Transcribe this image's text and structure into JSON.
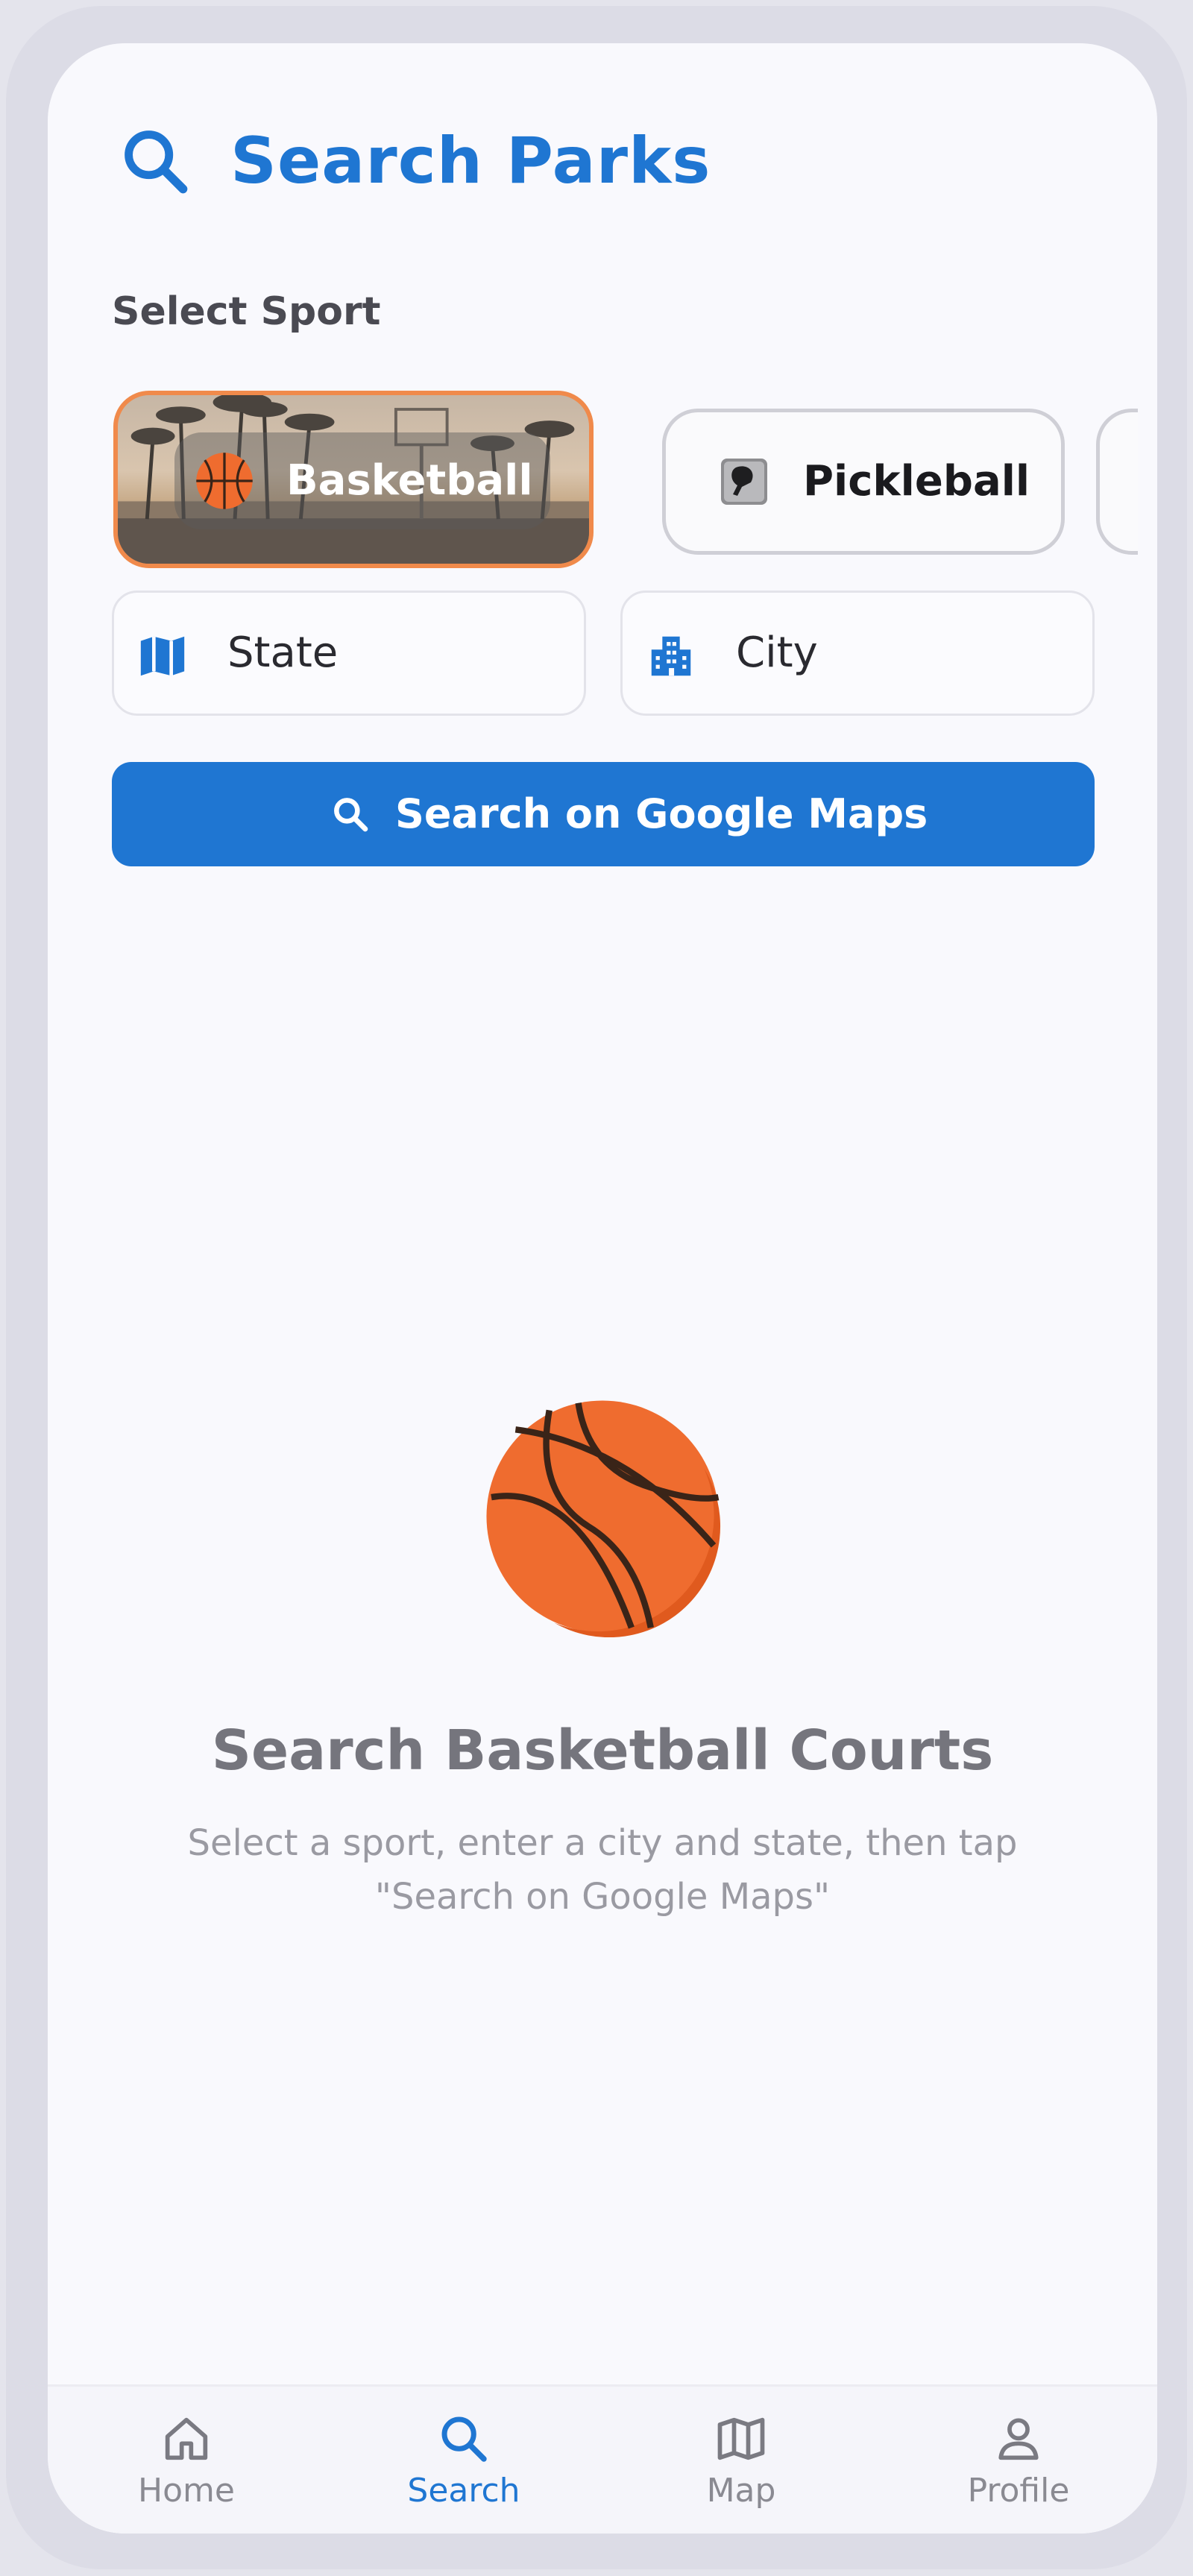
{
  "header": {
    "title": "Search Parks",
    "icon": "search-icon"
  },
  "sport_section": {
    "label": "Select Sport",
    "selected": "Basketball",
    "sports": [
      {
        "label": "Basketball",
        "icon": "basketball-icon",
        "selected": true
      },
      {
        "label": "Pickleball",
        "icon": "pickleball-paddle-icon",
        "selected": false
      }
    ]
  },
  "fields": {
    "state": {
      "placeholder": "State",
      "icon": "map-icon"
    },
    "city": {
      "placeholder": "City",
      "icon": "city-building-icon"
    }
  },
  "search_button": {
    "label": "Search on Google Maps",
    "icon": "search-icon"
  },
  "empty_state": {
    "icon": "basketball-icon",
    "title": "Search Basketball Courts",
    "description": "Select a sport, enter a city and state, then tap \"Search on Google Maps\""
  },
  "bottom_nav": {
    "active": "Search",
    "items": [
      {
        "label": "Home",
        "icon": "home-icon"
      },
      {
        "label": "Search",
        "icon": "search-icon"
      },
      {
        "label": "Map",
        "icon": "map-icon"
      },
      {
        "label": "Profile",
        "icon": "profile-icon"
      }
    ]
  },
  "colors": {
    "primary": "#1f76d2",
    "selected_border": "#f08a4b",
    "background": "#f9f9fd",
    "basketball_orange": "#ef6c2f"
  }
}
